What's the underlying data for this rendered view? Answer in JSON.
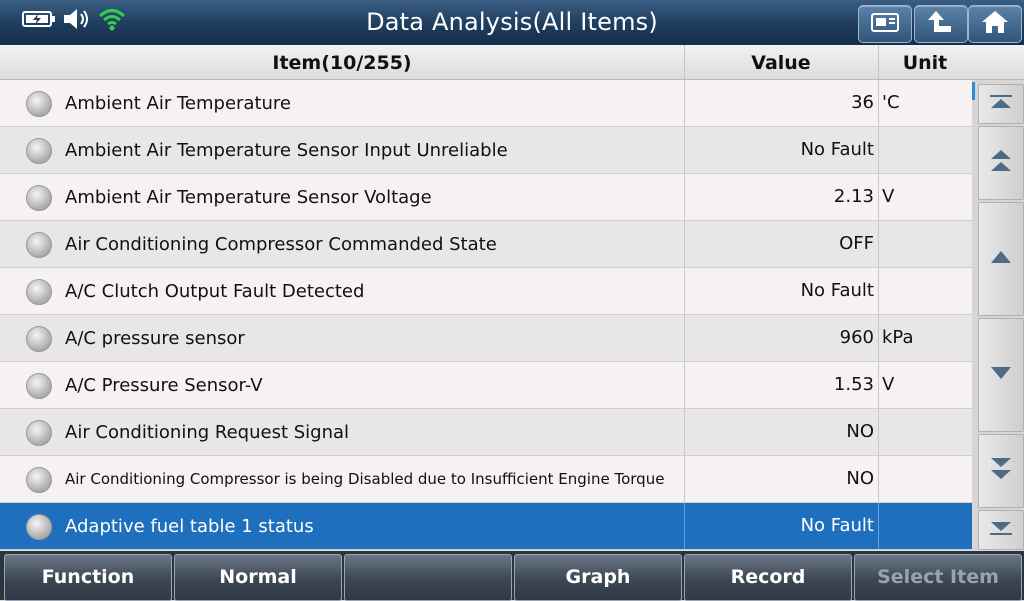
{
  "header": {
    "title": "Data Analysis(All Items)"
  },
  "icons": {
    "status": [
      "battery-charging-icon",
      "speaker-icon",
      "wifi-icon"
    ],
    "header_buttons": [
      "screenshot-icon",
      "back-arrow-icon",
      "home-icon"
    ],
    "scroll": [
      "scroll-top-icon",
      "page-up-icon",
      "scroll-up-icon",
      "scroll-down-icon",
      "page-down-icon",
      "scroll-bottom-icon"
    ]
  },
  "colors": {
    "header_bg": "#1f3c5c",
    "selected_row": "#1e6fbd",
    "wifi": "#2fd14a"
  },
  "table": {
    "columns": {
      "item": "Item(10/255)",
      "value": "Value",
      "unit": "Unit"
    },
    "rows": [
      {
        "item": "Ambient Air Temperature",
        "value": "36",
        "unit": "'C"
      },
      {
        "item": "Ambient Air Temperature Sensor Input Unreliable",
        "value": "No Fault",
        "unit": ""
      },
      {
        "item": "Ambient Air Temperature Sensor Voltage",
        "value": "2.13",
        "unit": "V"
      },
      {
        "item": "Air Conditioning Compressor Commanded State",
        "value": "OFF",
        "unit": ""
      },
      {
        "item": "A/C Clutch Output Fault Detected",
        "value": "No Fault",
        "unit": ""
      },
      {
        "item": "A/C pressure sensor",
        "value": "960",
        "unit": "kPa"
      },
      {
        "item": "A/C Pressure Sensor-V",
        "value": "1.53",
        "unit": "V"
      },
      {
        "item": "Air Conditioning Request Signal",
        "value": "NO",
        "unit": ""
      },
      {
        "item": "Air Conditioning Compressor is being Disabled due to Insufficient Engine Torque",
        "value": "NO",
        "unit": ""
      },
      {
        "item": "Adaptive fuel table 1 status",
        "value": "No Fault",
        "unit": "",
        "selected": true
      }
    ]
  },
  "footer": {
    "buttons": [
      "Function",
      "Normal",
      "",
      "Graph",
      "Record",
      "Select Item"
    ]
  }
}
